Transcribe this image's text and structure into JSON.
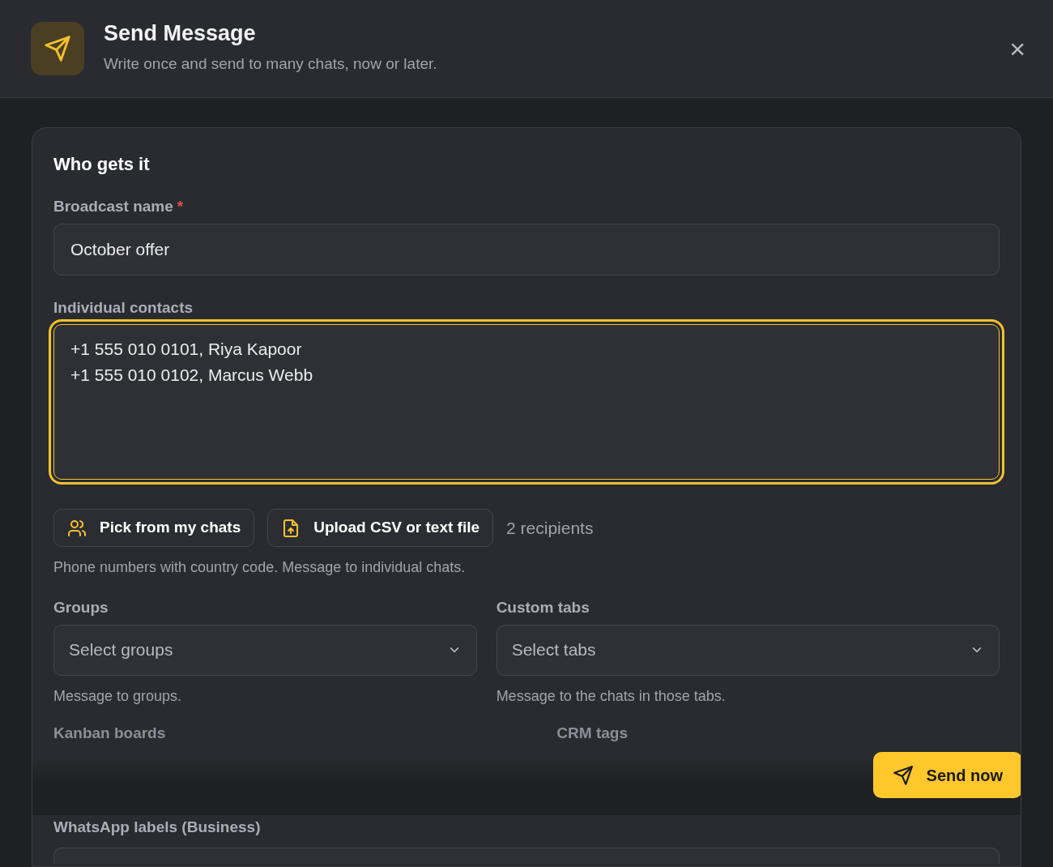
{
  "header": {
    "title": "Send Message",
    "subtitle": "Write once and send to many chats, now or later.",
    "close": "×"
  },
  "section": {
    "title": "Who gets it"
  },
  "broadcast_name": {
    "label": "Broadcast name",
    "required_mark": "*",
    "value": "October offer"
  },
  "contacts": {
    "label": "Individual contacts",
    "lines": [
      "+1 555 010 0101, Riya Kapoor",
      "+1 555 010 0102, Marcus Webb"
    ],
    "focused": true
  },
  "contact_actions": [
    {
      "kind": "people",
      "label": "Pick from my chats"
    },
    {
      "kind": "upload",
      "label": "Upload CSV or text file"
    }
  ],
  "recipients": "2 recipients",
  "contacts_help": "Phone numbers with country code. Message to individual chats.",
  "selects": [
    {
      "label": "Groups",
      "placeholder": "Select groups",
      "help": "Message to groups."
    },
    {
      "label": "Custom tabs",
      "placeholder": "Select tabs",
      "help": "Message to the chats in those tabs."
    }
  ],
  "faded_labels": [
    "Kanban boards",
    "CRM tags"
  ],
  "whatsapp_labels": {
    "label": "WhatsApp labels (Business)"
  },
  "send_button": {
    "label": "Send now"
  }
}
